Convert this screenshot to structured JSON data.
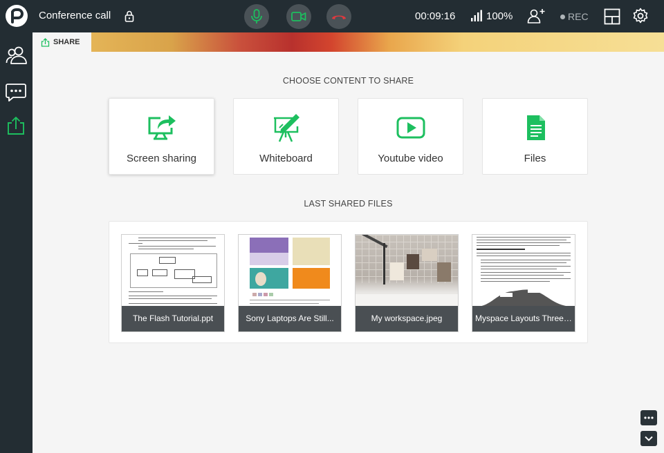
{
  "topbar": {
    "title": "Conference call",
    "timer": "00:09:16",
    "battery": "100%",
    "rec_label": "REC"
  },
  "tab": {
    "label": "SHARE"
  },
  "share": {
    "heading": "CHOOSE CONTENT TO SHARE",
    "options": [
      {
        "label": "Screen sharing",
        "icon": "screen-share-icon"
      },
      {
        "label": "Whiteboard",
        "icon": "whiteboard-icon"
      },
      {
        "label": "Youtube video",
        "icon": "youtube-icon"
      },
      {
        "label": "Files",
        "icon": "file-icon"
      }
    ]
  },
  "files": {
    "heading": "LAST SHARED FILES",
    "items": [
      {
        "name": "The Flash Tutorial.ppt"
      },
      {
        "name": "Sony Laptops Are Still..."
      },
      {
        "name": "My workspace.jpeg"
      },
      {
        "name": "Myspace Layouts Three I..."
      }
    ]
  },
  "colors": {
    "accent": "#1dbf5f",
    "topbar": "#232d33",
    "hangup": "#e0393e",
    "caption": "#4a4f53"
  }
}
